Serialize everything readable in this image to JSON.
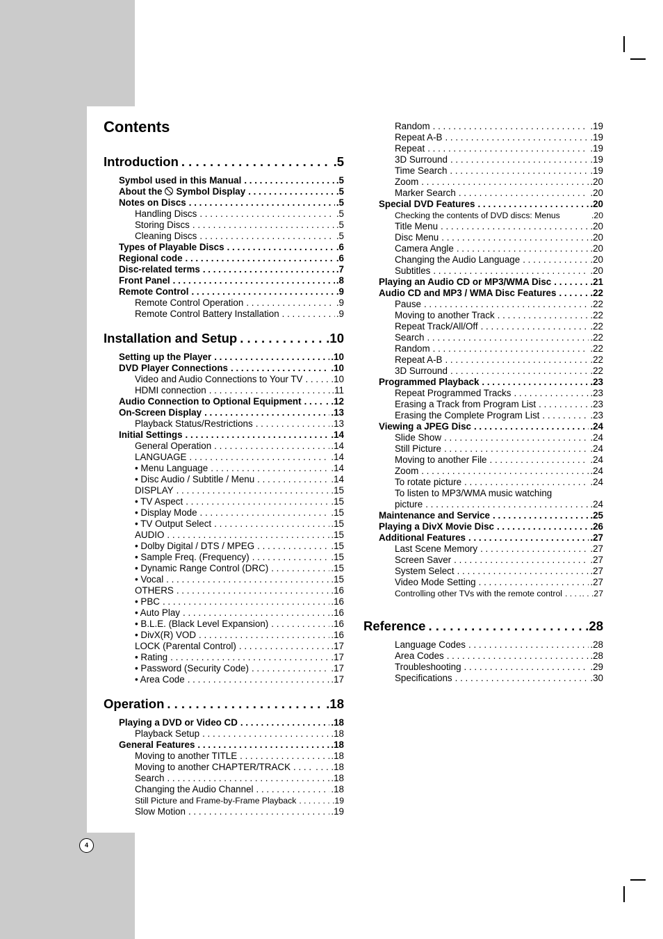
{
  "page": {
    "title": "Contents",
    "page_number": "4"
  },
  "toc_left": [
    {
      "level": 0,
      "label": "Introduction",
      "page": ".5"
    },
    {
      "level": 1,
      "label": "Symbol used in this Manual",
      "page": ".5"
    },
    {
      "level": 1,
      "label": "About the",
      "label_after_icon": "Symbol  Display",
      "icon": "prohibited-symbol-icon",
      "page": ".5"
    },
    {
      "level": 1,
      "label": "Notes on Discs",
      "page": ".5"
    },
    {
      "level": 2,
      "label": "Handling Discs",
      "page": ".5"
    },
    {
      "level": 2,
      "label": "Storing Discs",
      "page": ".5"
    },
    {
      "level": 2,
      "label": "Cleaning Discs",
      "page": ".5"
    },
    {
      "level": 1,
      "label": "Types of Playable Discs",
      "page": ".6"
    },
    {
      "level": 1,
      "label": "Regional code",
      "page": ".6"
    },
    {
      "level": 1,
      "label": "Disc-related terms",
      "page": ".7"
    },
    {
      "level": 1,
      "label": "Front Panel",
      "page": ".8"
    },
    {
      "level": 1,
      "label": "Remote Control",
      "page": ".9"
    },
    {
      "level": 2,
      "label": "Remote Control Operation",
      "page": ".9"
    },
    {
      "level": 2,
      "label": "Remote Control Battery Installation",
      "page": ".9"
    },
    {
      "level": 0,
      "label": "Installation and Setup",
      "page": ".10"
    },
    {
      "level": 1,
      "label": "Setting up the Player",
      "page": ".10"
    },
    {
      "level": 1,
      "label": "DVD Player Connections",
      "page": ".10"
    },
    {
      "level": 2,
      "label": "Video and Audio Connections to Your TV",
      "page": ". .10"
    },
    {
      "level": 2,
      "label": "HDMI connection",
      "page": ".11"
    },
    {
      "level": 1,
      "label": "Audio Connection to Optional Equipment",
      "page": ". .12"
    },
    {
      "level": 1,
      "label": "On-Screen Display",
      "page": ".13"
    },
    {
      "level": 2,
      "label": "Playback Status/Restrictions",
      "page": ".13"
    },
    {
      "level": 1,
      "label": "Initial Settings",
      "page": ".14"
    },
    {
      "level": 2,
      "label": "General Operation",
      "page": ".14"
    },
    {
      "level": 2,
      "label": "LANGUAGE",
      "page": ".14"
    },
    {
      "level": 2,
      "label": "• Menu Language",
      "page": ".14"
    },
    {
      "level": 2,
      "label": "• Disc Audio / Subtitle / Menu",
      "page": ".14"
    },
    {
      "level": 2,
      "label": "DISPLAY",
      "page": ".15"
    },
    {
      "level": 2,
      "label": "• TV Aspect",
      "page": ".15"
    },
    {
      "level": 2,
      "label": "• Display Mode",
      "page": ".15"
    },
    {
      "level": 2,
      "label": "• TV Output Select",
      "page": ".15"
    },
    {
      "level": 2,
      "label": "AUDIO",
      "page": ".15"
    },
    {
      "level": 2,
      "label": "• Dolby Digital / DTS / MPEG",
      "page": ".15"
    },
    {
      "level": 2,
      "label": "• Sample Freq. (Frequency)",
      "page": ".15"
    },
    {
      "level": 2,
      "label": "• Dynamic Range Control (DRC)",
      "page": ".15"
    },
    {
      "level": 2,
      "label": "• Vocal",
      "page": ".15"
    },
    {
      "level": 2,
      "label": "OTHERS",
      "page": ".16"
    },
    {
      "level": 2,
      "label": "• PBC",
      "page": ".16"
    },
    {
      "level": 2,
      "label": "• Auto Play",
      "page": ".16"
    },
    {
      "level": 2,
      "label": "• B.L.E. (Black Level Expansion)",
      "page": ".16"
    },
    {
      "level": 2,
      "label": "• DivX(R) VOD",
      "page": ".16"
    },
    {
      "level": 2,
      "label": "LOCK (Parental Control)",
      "page": ".17"
    },
    {
      "level": 2,
      "label": "• Rating",
      "page": ".17"
    },
    {
      "level": 2,
      "label": "• Password (Security Code)",
      "page": ".17"
    },
    {
      "level": 2,
      "label": "• Area Code",
      "page": ".17"
    },
    {
      "level": 0,
      "label": "Operation",
      "page": ".18"
    },
    {
      "level": 1,
      "label": "Playing a DVD or Video CD",
      "page": ".18"
    },
    {
      "level": 2,
      "label": "Playback Setup",
      "page": ".18"
    },
    {
      "level": 1,
      "label": "General Features",
      "page": ".18"
    },
    {
      "level": 2,
      "label": "Moving to another TITLE",
      "page": ".18"
    },
    {
      "level": 2,
      "label": "Moving to another CHAPTER/TRACK",
      "page": ". . . .18"
    },
    {
      "level": 2,
      "label": "Search",
      "page": ".18"
    },
    {
      "level": 2,
      "label": "Changing the Audio Channel",
      "page": ".18"
    },
    {
      "level": 2,
      "label": "Still Picture and Frame-by-Frame Playback",
      "page": ". . .19",
      "small": true
    },
    {
      "level": 2,
      "label": "Slow Motion",
      "page": ".19"
    }
  ],
  "toc_right": [
    {
      "level": 2,
      "label": "Random",
      "page": ".19"
    },
    {
      "level": 2,
      "label": "Repeat A-B",
      "page": ".19"
    },
    {
      "level": 2,
      "label": "Repeat",
      "page": ".19"
    },
    {
      "level": 2,
      "label": "3D Surround",
      "page": ".19"
    },
    {
      "level": 2,
      "label": "Time Search",
      "page": ".19"
    },
    {
      "level": 2,
      "label": "Zoom",
      "page": ".20"
    },
    {
      "level": 2,
      "label": "Marker Search",
      "page": ".20"
    },
    {
      "level": 1,
      "label": "Special DVD Features",
      "page": ".20"
    },
    {
      "level": 2,
      "label": "Checking the contents of DVD discs: Menus",
      "page": ".20",
      "small": true,
      "nodots": true
    },
    {
      "level": 2,
      "label": "Title Menu",
      "page": ".20"
    },
    {
      "level": 2,
      "label": "Disc Menu",
      "page": ".20"
    },
    {
      "level": 2,
      "label": "Camera Angle",
      "page": ".20"
    },
    {
      "level": 2,
      "label": "Changing the Audio Language",
      "page": ".20"
    },
    {
      "level": 2,
      "label": "Subtitles",
      "page": ".20"
    },
    {
      "level": 1,
      "label": "Playing an Audio CD or MP3/WMA Disc",
      "page": ". . .21"
    },
    {
      "level": 1,
      "label": "Audio CD and MP3 / WMA Disc Features",
      "page": ". .22"
    },
    {
      "level": 2,
      "label": "Pause",
      "page": ".22"
    },
    {
      "level": 2,
      "label": "Moving to another Track",
      "page": ".22"
    },
    {
      "level": 2,
      "label": "Repeat Track/All/Off",
      "page": ".22"
    },
    {
      "level": 2,
      "label": "Search",
      "page": ".22"
    },
    {
      "level": 2,
      "label": "Random",
      "page": ".22"
    },
    {
      "level": 2,
      "label": "Repeat A-B",
      "page": ".22"
    },
    {
      "level": 2,
      "label": "3D Surround",
      "page": ".22"
    },
    {
      "level": 1,
      "label": "Programmed Playback",
      "page": ".23"
    },
    {
      "level": 2,
      "label": "Repeat Programmed Tracks",
      "page": ".23"
    },
    {
      "level": 2,
      "label": "Erasing a Track from Program List",
      "page": ".23"
    },
    {
      "level": 2,
      "label": "Erasing the Complete Program List",
      "page": ".23"
    },
    {
      "level": 1,
      "label": "Viewing a JPEG Disc",
      "page": ".24"
    },
    {
      "level": 2,
      "label": "Slide Show",
      "page": ".24"
    },
    {
      "level": 2,
      "label": "Still Picture",
      "page": ".24"
    },
    {
      "level": 2,
      "label": "Moving to another File",
      "page": ".24"
    },
    {
      "level": 2,
      "label": "Zoom",
      "page": ".24"
    },
    {
      "level": 2,
      "label": "To rotate picture",
      "page": ".24"
    },
    {
      "level": 2,
      "label": "To listen to MP3/WMA music watching",
      "page": "",
      "nodots": true
    },
    {
      "level": 2,
      "label": "picture",
      "page": ".24"
    },
    {
      "level": 1,
      "label": "Maintenance and Service",
      "page": ".25"
    },
    {
      "level": 1,
      "label": "Playing a DivX Movie Disc",
      "page": ".26"
    },
    {
      "level": 1,
      "label": "Additional Features",
      "page": ".27"
    },
    {
      "level": 2,
      "label": "Last Scene Memory",
      "page": ".27"
    },
    {
      "level": 2,
      "label": "Screen Saver",
      "page": ".27"
    },
    {
      "level": 2,
      "label": "System Select",
      "page": ".27"
    },
    {
      "level": 2,
      "label": "Video Mode Setting",
      "page": ".27"
    },
    {
      "level": 2,
      "label": "Controlling other TVs with the remote control",
      "page": ". . .27",
      "small": true
    },
    {
      "level": 0,
      "label": "Reference",
      "page": ".28",
      "gap_before": true
    },
    {
      "level": 2,
      "label": "Language Codes",
      "page": ".28"
    },
    {
      "level": 2,
      "label": "Area Codes",
      "page": ".28"
    },
    {
      "level": 2,
      "label": "Troubleshooting",
      "page": ".29"
    },
    {
      "level": 2,
      "label": "Specifications",
      "page": ".30"
    }
  ]
}
